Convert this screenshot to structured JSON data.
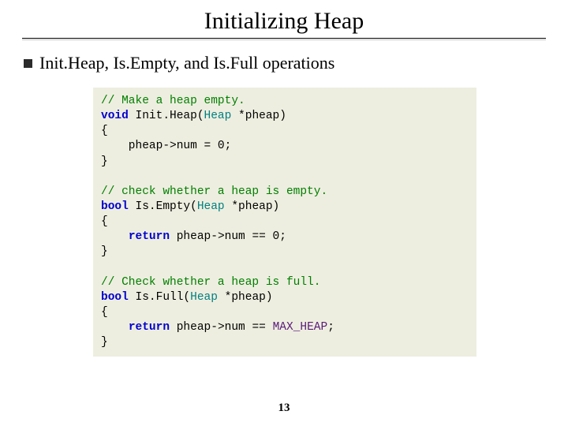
{
  "title": "Initializing Heap",
  "subtitle": "Init.Heap, Is.Empty, and Is.Full operations",
  "code": {
    "c1": "// Make a heap empty.",
    "kw_void": "void",
    "fn_init": " Init.Heap(",
    "ty_heap1": "Heap",
    "arg1": " *pheap)",
    "lb": "{",
    "body_init": "    pheap->num = 0;",
    "rb": "}",
    "blank": "",
    "c2": "// check whether a heap is empty.",
    "kw_bool1": "bool",
    "fn_empty": " Is.Empty(",
    "ty_heap2": "Heap",
    "arg2": " *pheap)",
    "ret_kw1": "return",
    "ret_body1": " pheap->num == 0;",
    "c3": "// Check whether a heap is full.",
    "kw_bool2": "bool",
    "fn_full": " Is.Full(",
    "ty_heap3": "Heap",
    "arg3": " *pheap)",
    "ret_kw2": "return",
    "ret_body2_a": " pheap->num == ",
    "const_max": "MAX_HEAP",
    "ret_body2_b": ";",
    "indent": "    "
  },
  "page_number": "13"
}
